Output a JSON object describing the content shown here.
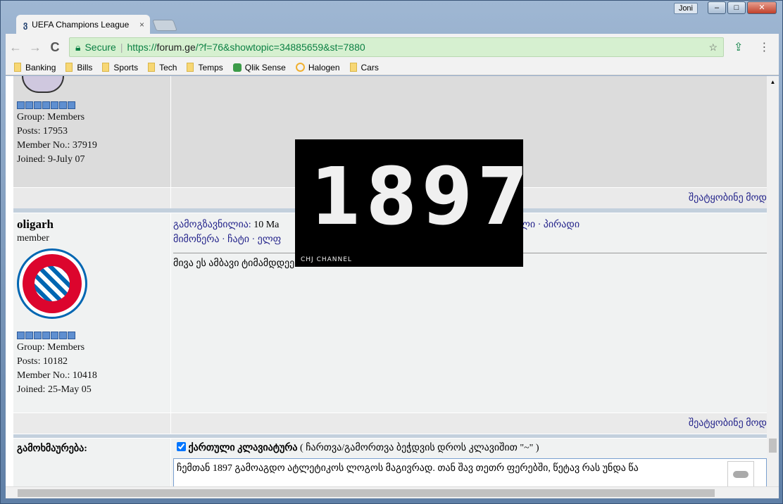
{
  "window": {
    "user": "Joni",
    "min": "–",
    "max": "□",
    "close": "✕"
  },
  "tab": {
    "title": "UEFA Champions League",
    "close": "×"
  },
  "toolbar": {
    "back": "←",
    "forward": "→",
    "reload": "C",
    "secure": "Secure",
    "url_scheme": "https://",
    "url_host": "forum.ge",
    "url_rest": "/?f=76&showtopic=34885659&st=7880",
    "star": "☆"
  },
  "bookmarks": [
    "Banking",
    "Bills",
    "Sports",
    "Tech",
    "Temps",
    "Qlik Sense",
    "Halogen",
    "Cars"
  ],
  "post1": {
    "group": "Group: Members",
    "posts": "Posts: 17953",
    "member_no": "Member No.: 37919",
    "joined": "Joined: 9-July 07",
    "report": "შეატყობინე მოდ"
  },
  "post2": {
    "username": "oligarh",
    "rank": "member",
    "group": "Group: Members",
    "posts": "Posts: 10182",
    "member_no": "Member No.: 10418",
    "joined": "Joined: 25-May 05",
    "sent_label": "გამოგზავნილია:",
    "sent_date": "10 Ma",
    "links_right": "ლი · პირადი",
    "links_line2": "მიმოწერა · ჩატი · ელფ",
    "body": "მივა ეს ამბავი ტიმამდდეე...........",
    "report": "შეატყობინე მოდ"
  },
  "reply": {
    "label": "გამოხმაურება:",
    "checkbox_label": "ქართული კლავიატურა",
    "checkbox_hint": "( ჩართვა/გამორთვა ბეჭდვის დროს კლავიშით \"~\" )",
    "text": "ჩემთან 1897 გამოაგდო ატლეტიკოს ლოგოს მაგივრად. თან შავ თეთრ ფერებში, წეტავ რას უნდა  წა"
  },
  "overlay": {
    "number": "1897",
    "caption": "CHJ CHANNEL"
  }
}
